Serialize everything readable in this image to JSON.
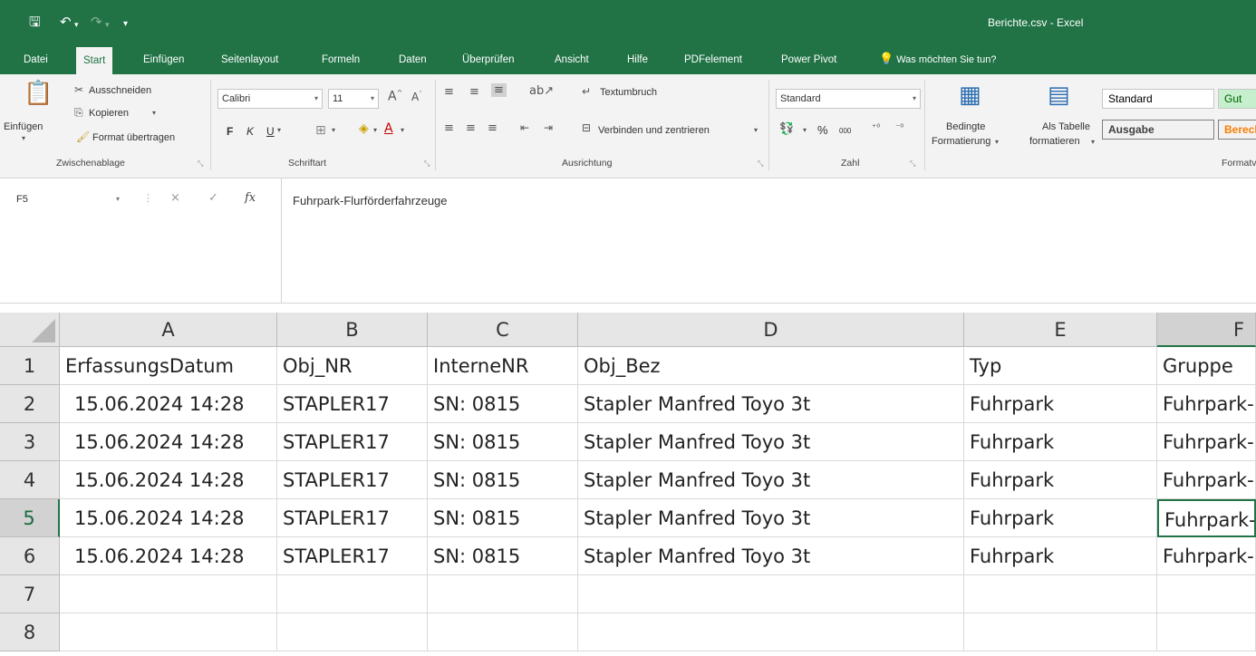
{
  "title_bar": {
    "title": "Berichte.csv  -  Excel"
  },
  "quick_access": {
    "save_icon": "save-icon",
    "undo_icon": "undo-icon",
    "redo_icon": "redo-icon",
    "customize_icon": "customize-icon"
  },
  "tabs": [
    "Datei",
    "Start",
    "Einfügen",
    "Seitenlayout",
    "Formeln",
    "Daten",
    "Überprüfen",
    "Ansicht",
    "Hilfe",
    "PDFelement",
    "Power Pivot"
  ],
  "active_tab": "Start",
  "tell_me": "Was möchten Sie tun?",
  "ribbon": {
    "clipboard": {
      "paste": "Einfügen",
      "cut": "Ausschneiden",
      "copy": "Kopieren",
      "format_painter": "Format übertragen",
      "group": "Zwischenablage"
    },
    "font": {
      "name": "Calibri",
      "size": "11",
      "bold": "F",
      "italic": "K",
      "underline": "U",
      "group": "Schriftart"
    },
    "alignment": {
      "wrap": "Textumbruch",
      "merge": "Verbinden und zentrieren",
      "group": "Ausrichtung"
    },
    "number": {
      "format": "Standard",
      "percent": "%",
      "thousands": "000",
      "group": "Zahl"
    },
    "styles": {
      "conditional_1": "Bedingte",
      "conditional_2": "Formatierung",
      "table_1": "Als Tabelle",
      "table_2": "formatieren",
      "style_standard": "Standard",
      "style_gut": "Gut",
      "style_ausgabe": "Ausgabe",
      "style_be": "Berechnung",
      "group": "Formatvorlagen"
    }
  },
  "formula_bar": {
    "name_box": "F5",
    "cancel": "×",
    "enter": "✓",
    "fx": "fx",
    "content": "Fuhrpark-Flurförderfahrzeuge"
  },
  "grid": {
    "columns": [
      "A",
      "B",
      "C",
      "D",
      "E",
      "F"
    ],
    "row_numbers": [
      "1",
      "2",
      "3",
      "4",
      "5",
      "6",
      "7",
      "8"
    ],
    "header_row": [
      "ErfassungsDatum",
      "Obj_NR",
      "InterneNR",
      "Obj_Bez",
      "Typ",
      "Gruppe"
    ],
    "data_rows": [
      [
        "15.06.2024 14:28",
        "STAPLER17",
        "SN: 0815",
        "Stapler Manfred Toyo 3t",
        "Fuhrpark",
        "Fuhrpark-Flurförderfahrzeuge"
      ],
      [
        "15.06.2024 14:28",
        "STAPLER17",
        "SN: 0815",
        "Stapler Manfred Toyo 3t",
        "Fuhrpark",
        "Fuhrpark-Flurförderfahrzeuge"
      ],
      [
        "15.06.2024 14:28",
        "STAPLER17",
        "SN: 0815",
        "Stapler Manfred Toyo 3t",
        "Fuhrpark",
        "Fuhrpark-Flurförderfahrzeuge"
      ],
      [
        "15.06.2024 14:28",
        "STAPLER17",
        "SN: 0815",
        "Stapler Manfred Toyo 3t",
        "Fuhrpark",
        "Fuhrpark-Flurförderfahrzeuge"
      ],
      [
        "15.06.2024 14:28",
        "STAPLER17",
        "SN: 0815",
        "Stapler Manfred Toyo 3t",
        "Fuhrpark",
        "Fuhrpark-Flurförderfahrzeuge"
      ]
    ],
    "active_cell": "F5"
  },
  "colors": {
    "accent": "#217346",
    "ribbon_bg": "#f3f3f3",
    "header_bg": "#e6e6e6",
    "gridline": "#d9d9d9"
  }
}
